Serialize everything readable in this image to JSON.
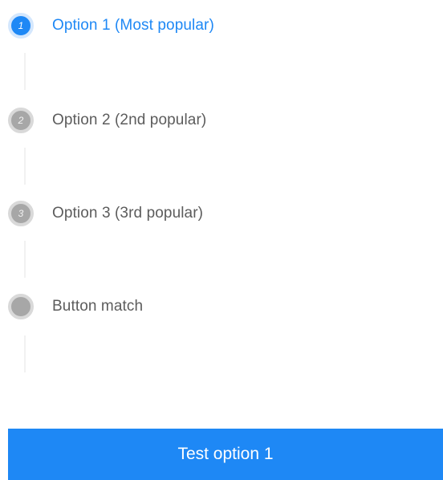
{
  "steps": [
    {
      "number": "1",
      "label": "Option 1 (Most popular)",
      "active": true
    },
    {
      "number": "2",
      "label": "Option 2 (2nd popular)",
      "active": false
    },
    {
      "number": "3",
      "label": "Option 3 (3rd popular)",
      "active": false
    },
    {
      "number": "",
      "label": "Button match",
      "active": false
    }
  ],
  "cta": {
    "label": "Test option 1"
  },
  "colors": {
    "accent": "#1e88f5",
    "inactive_dot": "#a7a7a7",
    "text": "#5c5c5c"
  }
}
